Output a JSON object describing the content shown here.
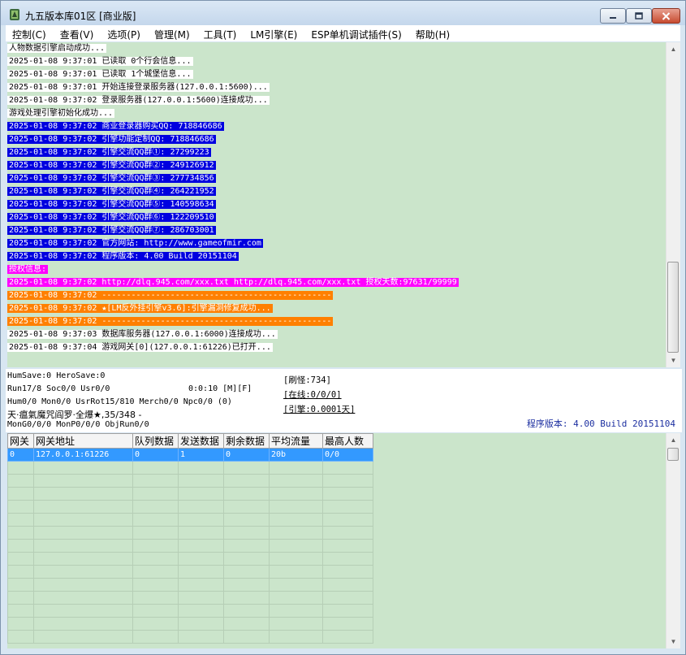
{
  "window": {
    "title": "九五版本库01区 [商业版]"
  },
  "menu": [
    "控制(C)",
    "查看(V)",
    "选项(P)",
    "管理(M)",
    "工具(T)",
    "LM引擎(E)",
    "ESP单机调试插件(S)",
    "帮助(H)"
  ],
  "log": [
    {
      "style": "white",
      "text": "人物数据引擎启动成功..."
    },
    {
      "style": "white",
      "text": "2025-01-08 9:37:01 已读取 0个行会信息..."
    },
    {
      "style": "white",
      "text": "2025-01-08 9:37:01 已读取 1个城堡信息..."
    },
    {
      "style": "white",
      "text": "2025-01-08 9:37:01 开始连接登录服务器(127.0.0.1:5600)..."
    },
    {
      "style": "white",
      "text": "2025-01-08 9:37:02 登录服务器(127.0.0.1:5600)连接成功..."
    },
    {
      "style": "white",
      "text": "游戏处理引擎初始化成功..."
    },
    {
      "style": "blue",
      "text": "2025-01-08 9:37:02 商业登录器购买QQ: 718846686"
    },
    {
      "style": "blue",
      "text": "2025-01-08 9:37:02 引擎功能定制QQ: 718846686"
    },
    {
      "style": "blue",
      "text": "2025-01-08 9:37:02 引擎交流QQ群①: 27299223"
    },
    {
      "style": "blue",
      "text": "2025-01-08 9:37:02 引擎交流QQ群②: 249126912"
    },
    {
      "style": "blue",
      "text": "2025-01-08 9:37:02 引擎交流QQ群③: 277734856"
    },
    {
      "style": "blue",
      "text": "2025-01-08 9:37:02 引擎交流QQ群④: 264221952"
    },
    {
      "style": "blue",
      "text": "2025-01-08 9:37:02 引擎交流QQ群⑤: 140598634"
    },
    {
      "style": "blue",
      "text": "2025-01-08 9:37:02 引擎交流QQ群⑥: 122209510"
    },
    {
      "style": "blue",
      "text": "2025-01-08 9:37:02 引擎交流QQ群⑦: 286703001"
    },
    {
      "style": "blue",
      "text": "2025-01-08 9:37:02 官方网站: http://www.gameofmir.com"
    },
    {
      "style": "blue",
      "text": "2025-01-08 9:37:02 程序版本: 4.00 Build 20151104"
    },
    {
      "style": "magenta",
      "text": "授权信息:"
    },
    {
      "style": "magenta",
      "text": "2025-01-08 9:37:02 http://dlq.945.com/xxx.txt http://dlq.945.com/xxx.txt 授权天数:97631/99999"
    },
    {
      "style": "orange",
      "text": "2025-01-08 9:37:02 -----------------------------------------------"
    },
    {
      "style": "orange",
      "text": "2025-01-08 9:37:02 ★[LM反外挂引擎v3.6]:引擎漏洞修复成功..."
    },
    {
      "style": "orange",
      "text": "2025-01-08 9:37:02 -----------------------------------------------"
    },
    {
      "style": "white",
      "text": "2025-01-08 9:37:03 数据库服务器(127.0.0.1:6000)连接成功..."
    },
    {
      "style": "white",
      "text": "2025-01-08 9:37:04 游戏网关[0](127.0.0.1:61226)已打开..."
    }
  ],
  "status": {
    "line1": "HumSave:0 HeroSave:0",
    "line2": "Run17/8 Soc0/0 Usr0/0",
    "time": "0:0:10 [M][F]",
    "line3": "Hum0/0 Mon0/0 UsrRot15/810 Merch0/0 Npc0/0 (0)",
    "line4": "天·瘟氣魔咒阎罗·全爆★,35/348 -",
    "line5": "MonG0/0/0 MonP0/0/0 ObjRun0/0",
    "refresh": "[刷怪:734]",
    "online": "[在线:0/0/0]",
    "engine": "[引擎:0.0001天]",
    "version": "程序版本: 4.00 Build 20151104"
  },
  "grid": {
    "headers": [
      "网关",
      "网关地址",
      "队列数据",
      "发送数据",
      "剩余数据",
      "平均流量",
      "最高人数"
    ],
    "rows": [
      [
        "0",
        "127.0.0.1:61226",
        "0",
        "1",
        "0",
        "20b",
        "0/0"
      ]
    ]
  },
  "colors": {
    "log_bg": "#cbe5cb",
    "blue": "#0000e0",
    "magenta": "#ff00ff",
    "orange": "#ff8000",
    "selection": "#3399ff"
  }
}
